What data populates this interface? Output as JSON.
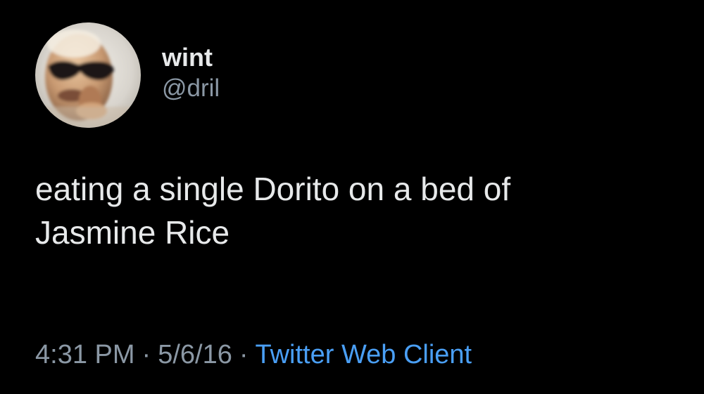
{
  "tweet": {
    "author": {
      "display_name": "wint",
      "handle": "@dril",
      "avatar_icon": "profile-photo"
    },
    "text_lines": [
      "eating a single Dorito on a bed of",
      "Jasmine Rice"
    ],
    "meta": {
      "time": "4:31 PM",
      "separator": "·",
      "date": "5/6/16",
      "source": "Twitter Web Client"
    }
  },
  "colors": {
    "background": "#000000",
    "text": "#e7e9ea",
    "secondary": "#8b98a5",
    "link": "#4a9ff5"
  }
}
